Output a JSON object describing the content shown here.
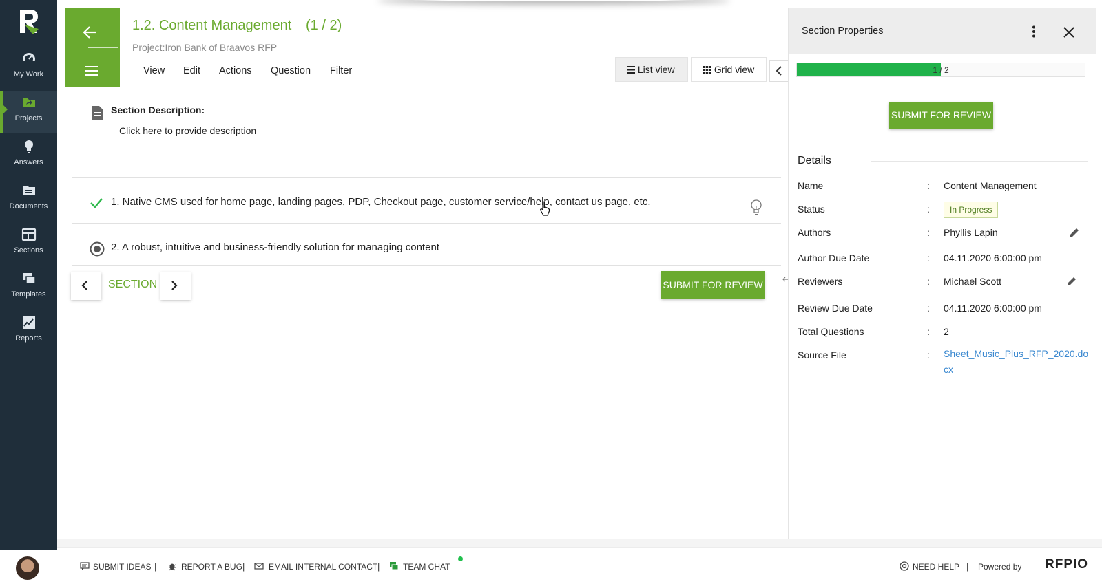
{
  "sidebar": {
    "items": [
      {
        "label": "My Work",
        "icon": "gauge-icon"
      },
      {
        "label": "Projects",
        "icon": "folder-share-icon"
      },
      {
        "label": "Answers",
        "icon": "lightbulb-icon"
      },
      {
        "label": "Documents",
        "icon": "documents-icon"
      },
      {
        "label": "Sections",
        "icon": "sections-icon"
      },
      {
        "label": "Templates",
        "icon": "templates-icon"
      },
      {
        "label": "Reports",
        "icon": "reports-icon"
      }
    ],
    "active": "Projects"
  },
  "header": {
    "title": "1.2. Content Management",
    "count": "(1 / 2)",
    "project": "Project:Iron Bank of Braavos RFP",
    "menu": [
      "View",
      "Edit",
      "Actions",
      "Question",
      "Filter"
    ],
    "list_view": "List view",
    "grid_view": "Grid view"
  },
  "section": {
    "desc_label": "Section Description:",
    "desc_placeholder": "Click here to provide description",
    "questions": [
      {
        "text": "1. Native CMS used for home page, landing pages, PDP, Checkout page, customer service/help, contact us page, etc.",
        "status": "check-icon"
      },
      {
        "text": "2. A robust, intuitive and business-friendly solution for managing content",
        "status": "radio-selected-icon"
      }
    ],
    "nav_label": "SECTION",
    "submit_label": "SUBMIT FOR REVIEW"
  },
  "panel": {
    "title": "Section Properties",
    "progress_text": "1 / 2",
    "progress_fraction": 0.5,
    "submit_label": "SUBMIT FOR REVIEW",
    "details_title": "Details",
    "fields": {
      "name_label": "Name",
      "name_value": "Content Management",
      "status_label": "Status",
      "status_value": "In Progress",
      "authors_label": "Authors",
      "authors_value": "Phyllis Lapin",
      "author_due_label": "Author Due Date",
      "author_due_value": "04.11.2020 6:00:00 pm",
      "reviewers_label": "Reviewers",
      "reviewers_value": "Michael Scott",
      "review_due_label": "Review Due Date",
      "review_due_value": "04.11.2020 6:00:00 pm",
      "total_label": "Total Questions",
      "total_value": "2",
      "source_label": "Source File",
      "source_value": "Sheet_Music_Plus_RFP_2020.docx"
    },
    "colon": ":"
  },
  "footer": {
    "submit_ideas": "SUBMIT IDEAS",
    "report_bug": "REPORT A BUG",
    "email_contact": "EMAIL INTERNAL CONTACT",
    "team_chat": "TEAM CHAT",
    "need_help": "NEED HELP",
    "powered_by": "Powered by",
    "brand": "RFPIO",
    "sep": "|"
  },
  "colors": {
    "accent": "#6aaa2f",
    "sidebar": "#1f2e3a",
    "progress": "#20b24a",
    "link": "#3a88d0"
  }
}
